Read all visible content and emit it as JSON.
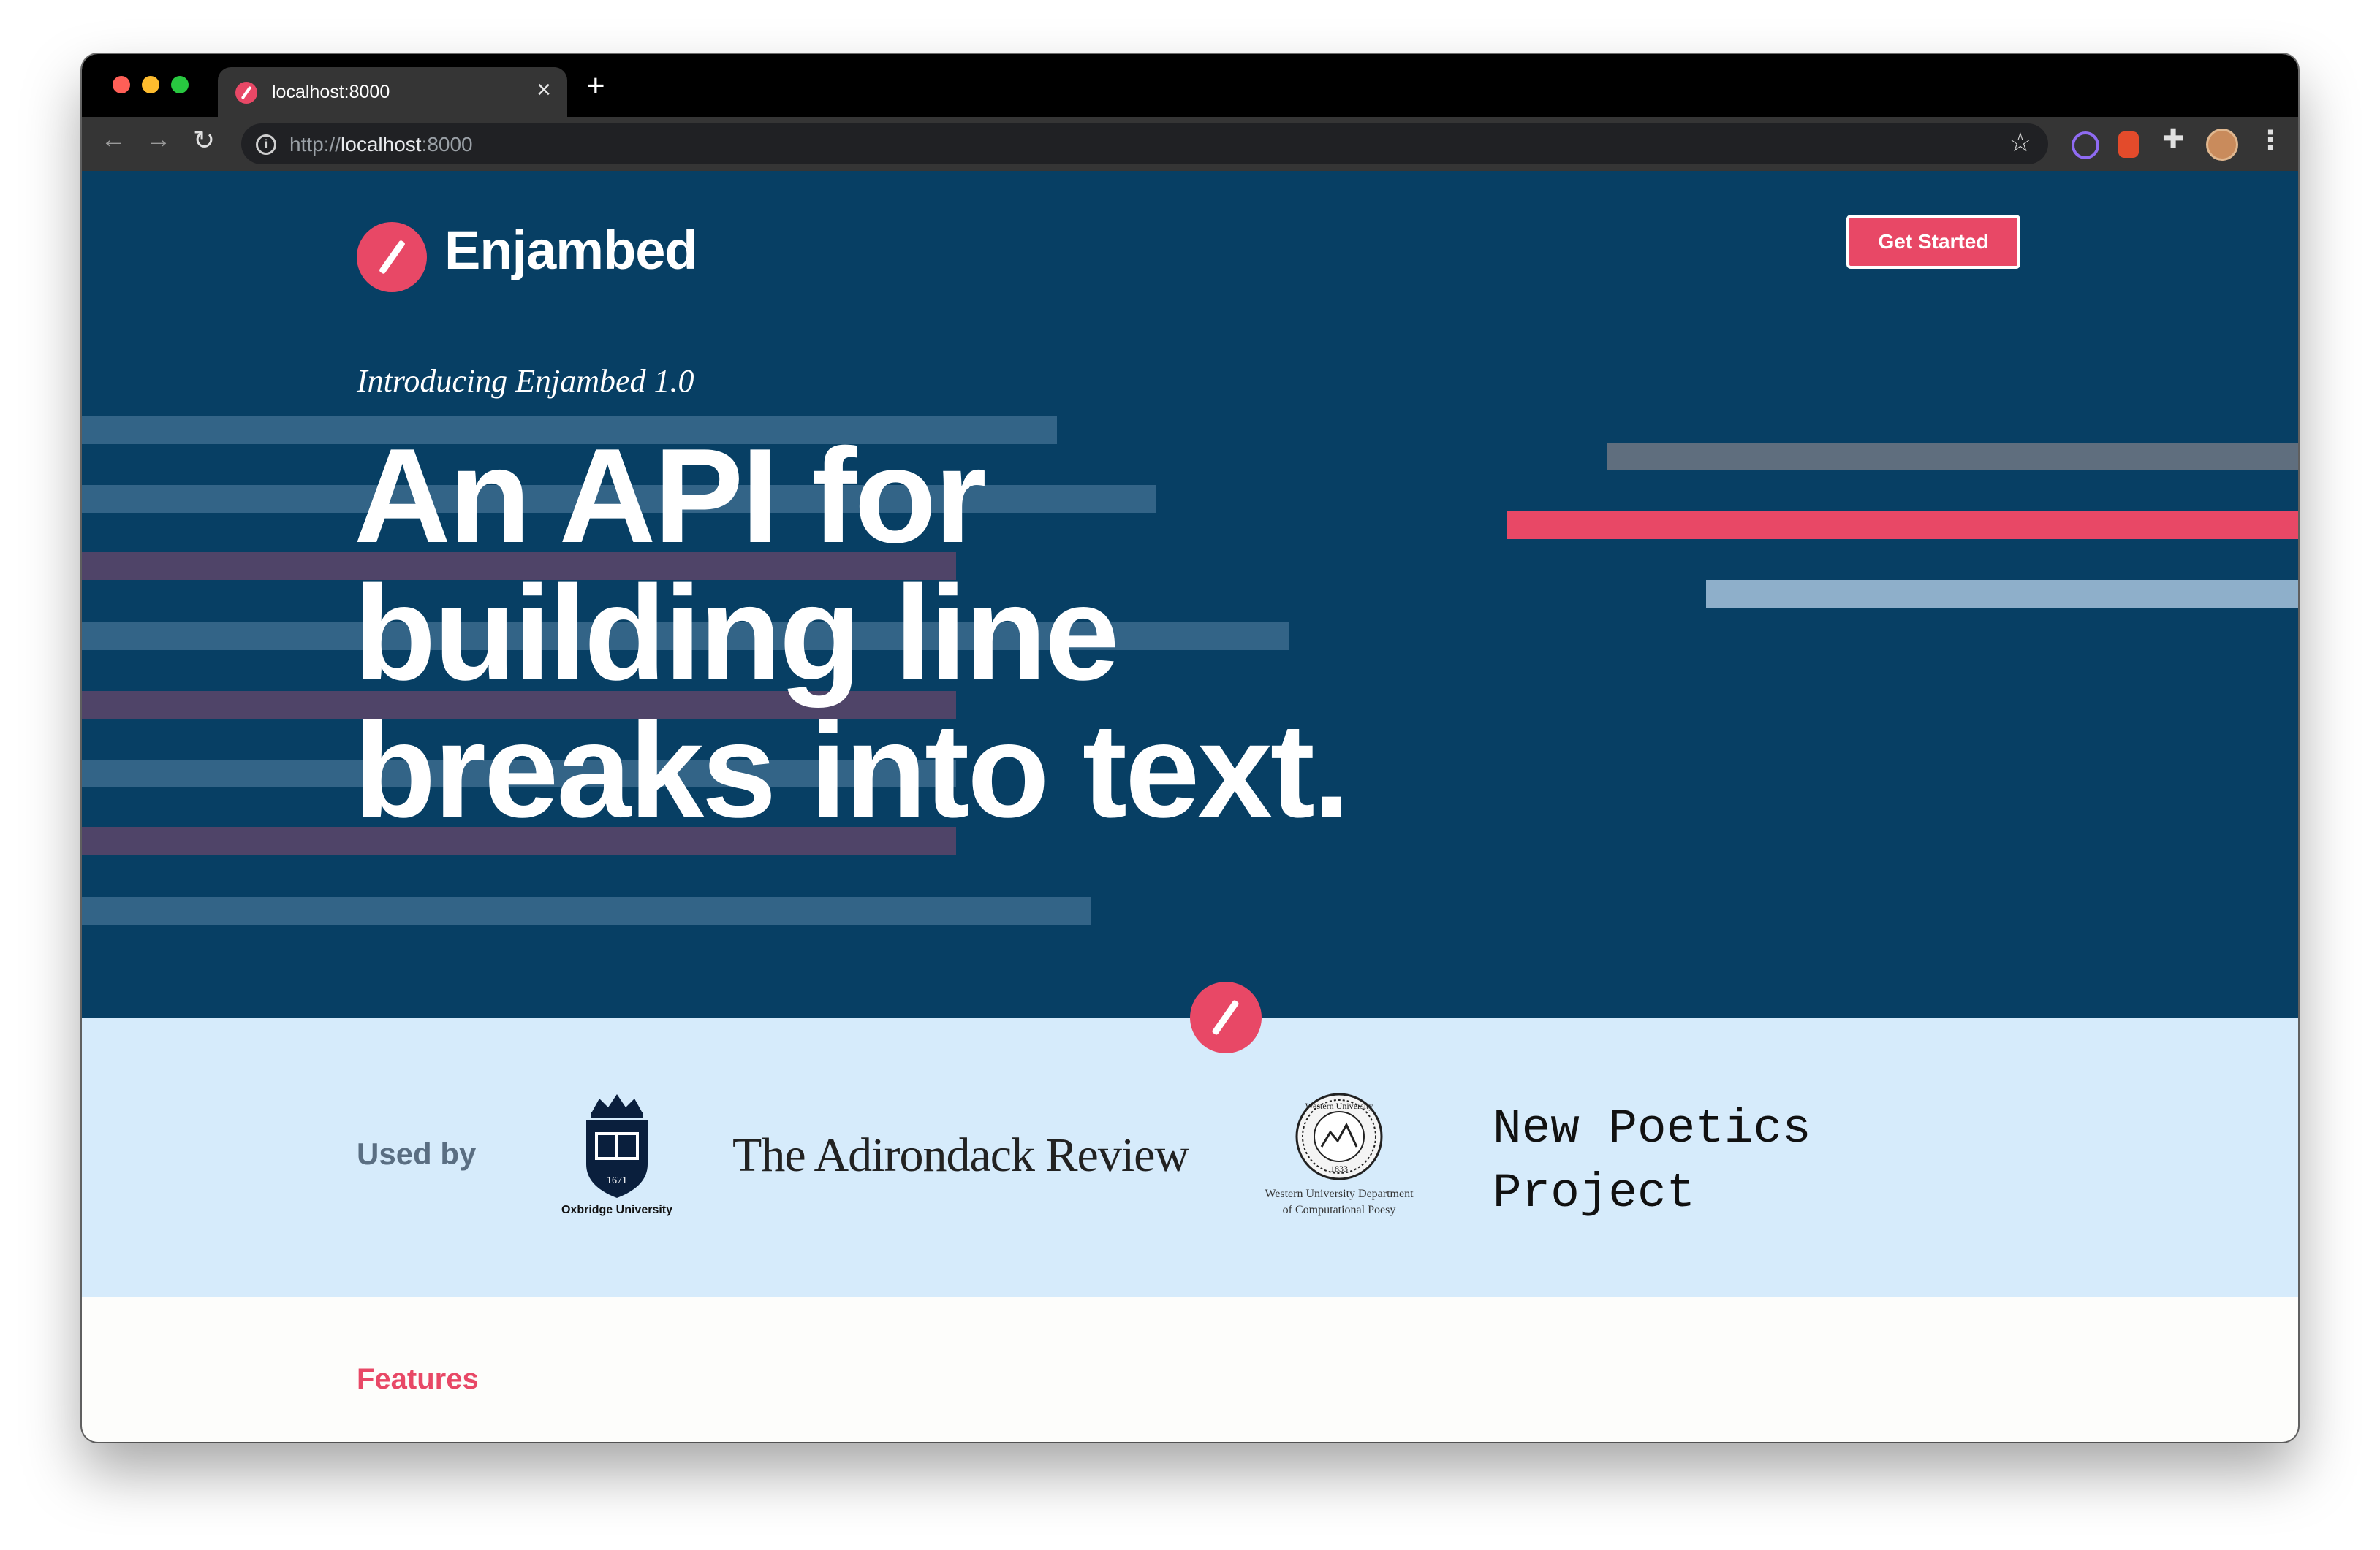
{
  "browser": {
    "tab_title": "localhost:8000",
    "tab_close": "×",
    "new_tab": "+",
    "url_scheme": "http://",
    "url_host": "localhost",
    "url_port": ":8000",
    "icons": [
      "back-arrow-icon",
      "forward-arrow-icon",
      "reload-icon",
      "info-icon",
      "star-icon",
      "extension-icon",
      "puzzle-icon",
      "profile-avatar",
      "menu-icon"
    ]
  },
  "header": {
    "logo_text": "Enjambed",
    "cta_label": "Get Started"
  },
  "hero": {
    "eyebrow": "Introducing Enjambed 1.0",
    "headline_line1": "An API for",
    "headline_line2": "building line",
    "headline_line3": "breaks into text."
  },
  "logos": {
    "used_by_label": "Used by",
    "oxbridge_caption": "Oxbridge University",
    "oxbridge_year": "1671",
    "adirondack": "The Adirondack Review",
    "western_caption_1": "Western University Department",
    "western_caption_2": "of Computational Poesy",
    "western_seal_text": "Western University",
    "western_seal_year": "1833",
    "npp_line1": "New Poetics",
    "npp_line2": "Project"
  },
  "features": {
    "label": "Features"
  },
  "colors": {
    "hero_bg": "#073f64",
    "accent": "#e84866",
    "logos_bg": "#d6ebfb",
    "page_bg": "#fdfdfb"
  }
}
